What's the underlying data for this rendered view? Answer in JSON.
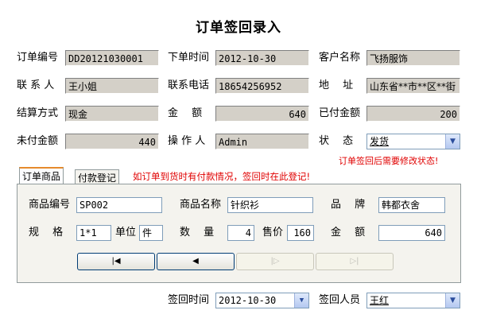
{
  "title": "订单签回录入",
  "order": {
    "order_no_label": "订单编号",
    "order_no": "DD20121030001",
    "order_time_label": "下单时间",
    "order_time": "2012-10-30",
    "customer_label": "客户名称",
    "customer": "飞扬服饰",
    "contact_label": "联 系 人",
    "contact": "王小姐",
    "phone_label": "联系电话",
    "phone": "18654256952",
    "address_label": "地　 址",
    "address": "山东省**市**区**街",
    "settle_label": "结算方式",
    "settle": "现金",
    "amount_label": "金　 额",
    "amount": "640",
    "paid_label": "已付金额",
    "paid": "200",
    "unpaid_label": "未付金额",
    "unpaid": "440",
    "operator_label": "操 作 人",
    "operator": "Admin",
    "status_label": "状　 态",
    "status": "发货",
    "status_note": "订单签回后需要修改状态!"
  },
  "tabs": {
    "product": "订单商品",
    "payment": "付款登记",
    "note": "如订单到货时有付款情况，签回时在此登记!"
  },
  "product": {
    "code_label": "商品编号",
    "code": "SP002",
    "name_label": "商品名称",
    "name": "针织衫",
    "brand_label": "品　 牌",
    "brand": "韩都衣舍",
    "spec_label": "规　 格",
    "spec": "1*1",
    "unit_label": "单位",
    "unit": "件",
    "qty_label": "数　 量",
    "qty": "4",
    "price_label": "售价",
    "price": "160",
    "amount_label": "金　 额",
    "amount": "640"
  },
  "nav": {
    "first": "|◀",
    "prev": "◀",
    "next": "|▷",
    "last": "▷|"
  },
  "footer": {
    "sign_time_label": "签回时间",
    "sign_time": "2012-10-30",
    "sign_person_label": "签回人员",
    "sign_person": "王红"
  },
  "colors": {
    "field_bg": "#d4d0c8",
    "note_red": "#e00000",
    "tab_highlight": "#e68b2c"
  }
}
